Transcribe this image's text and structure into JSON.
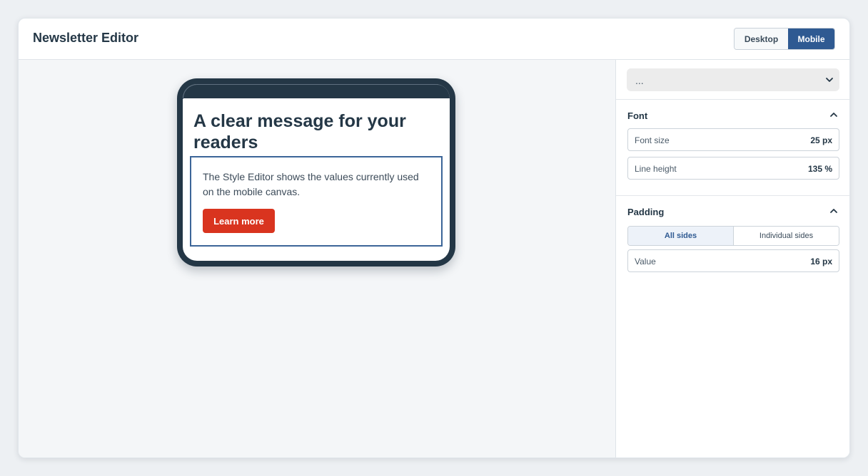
{
  "header": {
    "title": "Newsletter Editor",
    "view_desktop": "Desktop",
    "view_mobile": "Mobile"
  },
  "preview": {
    "headline": "A clear message for your readers",
    "body": "The Style Editor shows the values currently used on the mobile canvas.",
    "cta_label": "Learn more"
  },
  "style_panel": {
    "element_select": "...",
    "font": {
      "title": "Font",
      "font_size_label": "Font size",
      "font_size_value": "25 px",
      "line_height_label": "Line height",
      "line_height_value": "135 %"
    },
    "padding": {
      "title": "Padding",
      "tab_all": "All sides",
      "tab_individual": "Individual sides",
      "value_label": "Value",
      "value": "16 px"
    }
  },
  "colors": {
    "accent": "#2f5a92",
    "cta": "#d9341f",
    "phone_frame": "#243746"
  }
}
